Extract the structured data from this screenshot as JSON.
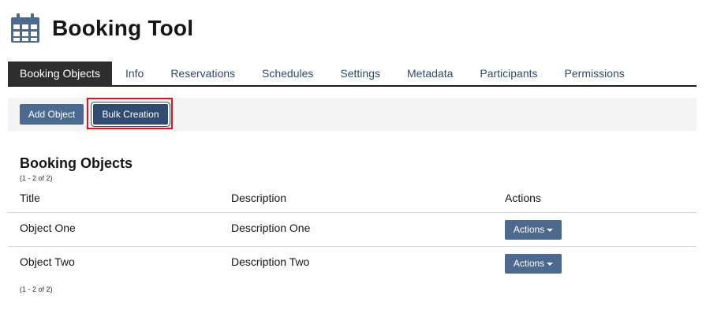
{
  "header": {
    "title": "Booking Tool",
    "icon": "calendar-icon"
  },
  "tabs": [
    {
      "label": "Booking Objects",
      "active": true
    },
    {
      "label": "Info"
    },
    {
      "label": "Reservations"
    },
    {
      "label": "Schedules"
    },
    {
      "label": "Settings"
    },
    {
      "label": "Metadata"
    },
    {
      "label": "Participants"
    },
    {
      "label": "Permissions"
    }
  ],
  "toolbar": {
    "add_label": "Add Object",
    "bulk_label": "Bulk Creation"
  },
  "section": {
    "title": "Booking Objects",
    "count_top": "(1 - 2 of 2)",
    "count_bottom": "(1 - 2 of 2)"
  },
  "table": {
    "headers": [
      "Title",
      "Description",
      "Actions"
    ],
    "rows": [
      {
        "title": "Object One",
        "description": "Description One",
        "action_label": "Actions"
      },
      {
        "title": "Object Two",
        "description": "Description Two",
        "action_label": "Actions"
      }
    ]
  },
  "colors": {
    "button": "#4c6a8f",
    "button_active": "#2f4b6f",
    "highlight": "#e0141e",
    "tab_active_bg": "#2e2e2e",
    "link": "#2d4a6e"
  }
}
